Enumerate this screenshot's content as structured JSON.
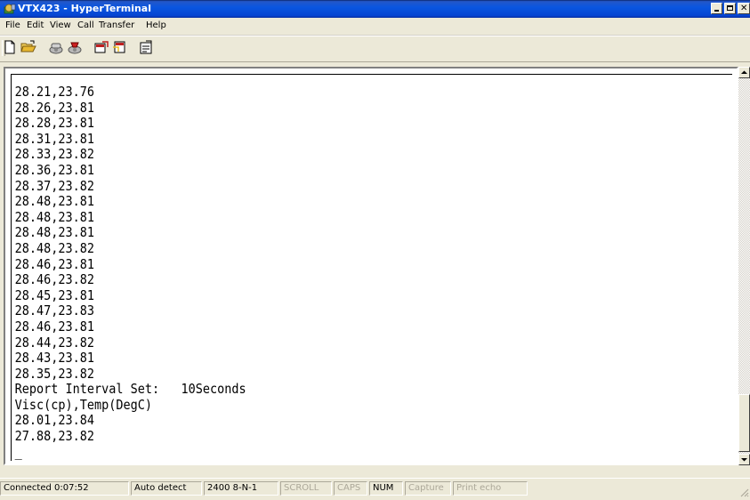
{
  "window": {
    "title": "VTX423 - HyperTerminal"
  },
  "menu": [
    "File",
    "Edit",
    "View",
    "Call",
    "Transfer",
    "Help"
  ],
  "toolbar": {
    "buttons": [
      {
        "name": "new-connection",
        "icon": "new-document-icon"
      },
      {
        "name": "open",
        "icon": "open-folder-icon"
      },
      {
        "name": "call",
        "icon": "phone-icon"
      },
      {
        "name": "disconnect",
        "icon": "disconnect-icon"
      },
      {
        "name": "send",
        "icon": "send-file-icon"
      },
      {
        "name": "receive",
        "icon": "receive-file-icon"
      },
      {
        "name": "properties",
        "icon": "properties-icon"
      }
    ]
  },
  "terminal": {
    "lines": [
      "28.21,23.76",
      "28.26,23.81",
      "28.28,23.81",
      "28.31,23.81",
      "28.33,23.82",
      "28.36,23.81",
      "28.37,23.82",
      "28.48,23.81",
      "28.48,23.81",
      "28.48,23.81",
      "28.48,23.82",
      "28.46,23.81",
      "28.46,23.82",
      "28.45,23.81",
      "28.47,23.83",
      "28.46,23.81",
      "28.44,23.82",
      "28.43,23.81",
      "28.35,23.82",
      "Report Interval Set:   10Seconds",
      "Visc(cp),Temp(DegC)",
      "28.01,23.84",
      "27.88,23.82",
      "_"
    ]
  },
  "status": {
    "connected": "Connected 0:07:52",
    "detect": "Auto detect",
    "settings": "2400 8-N-1",
    "scroll": "SCROLL",
    "caps": "CAPS",
    "num": "NUM",
    "capture": "Capture",
    "print_echo": "Print echo"
  },
  "colors": {
    "title_bar": "#0a56e0",
    "chrome": "#ece9d8",
    "terminal_bg": "#ffffff"
  }
}
